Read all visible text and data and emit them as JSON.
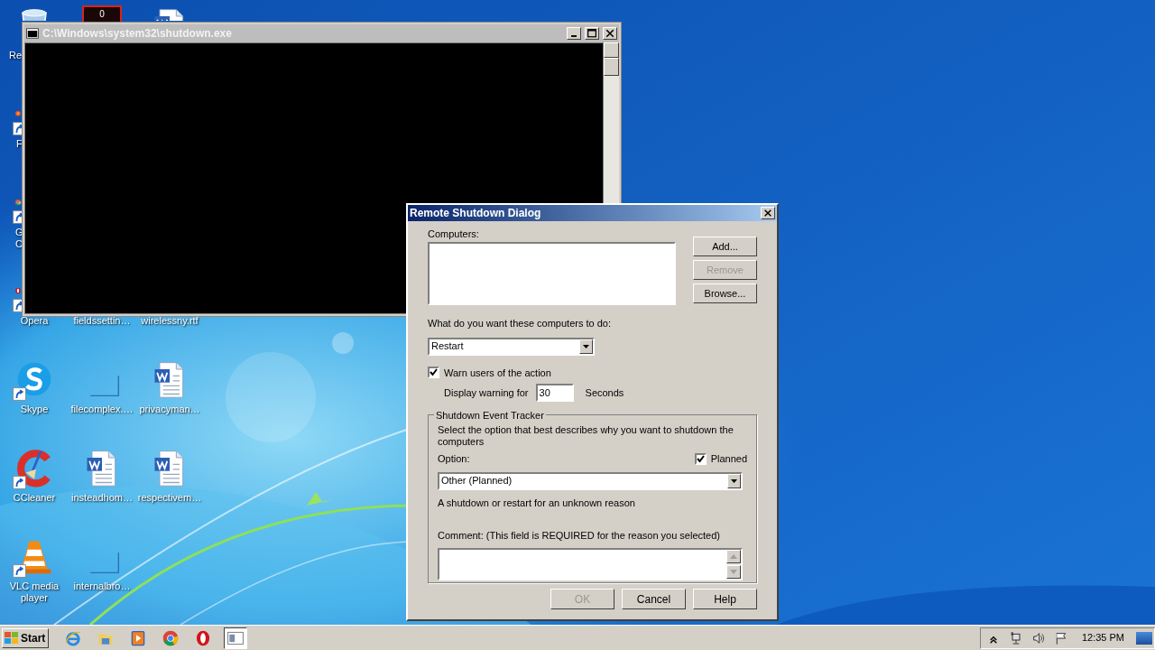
{
  "desktop_icons": [
    {
      "kind": "recycle",
      "shortcut": false,
      "label_lines": [
        "Re"
      ]
    },
    {
      "kind": "counter",
      "shortcut": false,
      "text": "0"
    },
    {
      "kind": "word",
      "shortcut": false
    },
    {
      "kind": "firefox",
      "shortcut": true,
      "label_lines": [
        "F"
      ]
    },
    {
      "kind": "chrome",
      "shortcut": true,
      "label_lines": [
        "G",
        "C"
      ]
    },
    {
      "kind": "opera",
      "shortcut": true,
      "label_lines": [
        "Opera"
      ]
    },
    {
      "kind": "none",
      "shortcut": false,
      "label_lines": [
        "fieldssettin…"
      ]
    },
    {
      "kind": "none",
      "shortcut": false,
      "label_lines": [
        "wirelessny.rtf"
      ]
    },
    {
      "kind": "skype",
      "shortcut": true,
      "label_lines": [
        "Skype"
      ]
    },
    {
      "kind": "blank",
      "shortcut": false,
      "label_lines": [
        "filecomplex.…"
      ]
    },
    {
      "kind": "word",
      "shortcut": false,
      "label_lines": [
        "privacyman…"
      ]
    },
    {
      "kind": "ccleaner",
      "shortcut": true,
      "label_lines": [
        "CCleaner"
      ]
    },
    {
      "kind": "word",
      "shortcut": false,
      "label_lines": [
        "insteadhom…"
      ]
    },
    {
      "kind": "word",
      "shortcut": false,
      "label_lines": [
        "respectivem…"
      ]
    },
    {
      "kind": "vlc",
      "shortcut": true,
      "label_lines": [
        "VLC media",
        "player"
      ]
    },
    {
      "kind": "blank",
      "shortcut": false,
      "label_lines": [
        "internalbro…"
      ]
    }
  ],
  "console_window": {
    "title": "C:\\Windows\\system32\\shutdown.exe"
  },
  "dialog": {
    "title": "Remote Shutdown Dialog",
    "computers_label": "Computers:",
    "side_buttons": [
      {
        "label": "Add...",
        "disabled": false
      },
      {
        "label": "Remove",
        "disabled": true
      },
      {
        "label": "Browse...",
        "disabled": false
      }
    ],
    "action_label": "What do you want these computers to do:",
    "action": "Restart",
    "warn": {
      "label": "Warn users of the action",
      "checked": true
    },
    "warning_label": "Display warning for",
    "warning_seconds": "30",
    "seconds_label": "Seconds",
    "tracker": {
      "legend": "Shutdown Event Tracker",
      "description": "Select the option that best describes why you want to shutdown the computers",
      "option_label": "Option:",
      "planned": {
        "label": "Planned",
        "checked": true
      },
      "option": "Other (Planned)",
      "reason": "A shutdown or restart for an unknown reason",
      "comment_label": "Comment: (This field is REQUIRED for the reason you selected)"
    },
    "buttons": [
      {
        "label": "OK",
        "disabled": true
      },
      {
        "label": "Cancel",
        "disabled": false
      },
      {
        "label": "Help",
        "disabled": false
      }
    ]
  },
  "taskbar": {
    "start_label": "Start",
    "items": [
      {
        "kind": "ie",
        "selected": false
      },
      {
        "kind": "explorer",
        "selected": false
      },
      {
        "kind": "media",
        "selected": false
      },
      {
        "kind": "chrome",
        "selected": false
      },
      {
        "kind": "opera",
        "selected": false
      },
      {
        "kind": "console",
        "selected": true
      }
    ],
    "clock": "12:35 PM"
  }
}
